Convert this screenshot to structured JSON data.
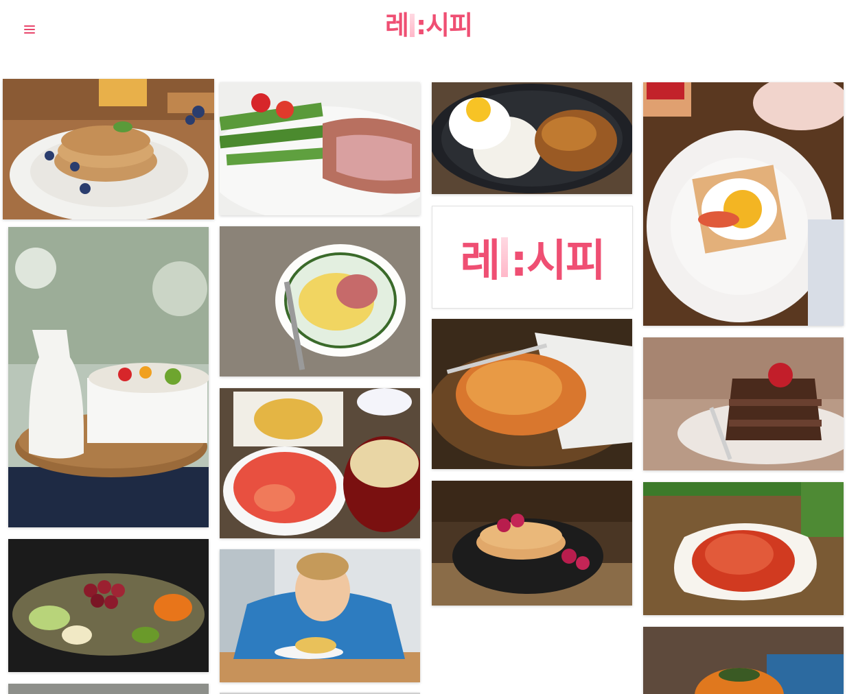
{
  "header": {
    "logo_left": "레",
    "logo_right": ":시피",
    "menu_icon": "hamburger-menu-icon"
  },
  "promo_card": {
    "logo_left": "레",
    "logo_right": ":시피"
  },
  "feed": {
    "items": [
      {
        "subject": "pancake-stack-blueberries"
      },
      {
        "subject": "steak-asparagus-tomato"
      },
      {
        "subject": "fried-egg-rice-kimchi-stirfry"
      },
      {
        "subject": "egg-toast-floral-plate"
      },
      {
        "subject": "milk-bottle-fruit-granola"
      },
      {
        "subject": "carbonara-spaghetti"
      },
      {
        "subject": "korean-pancake-basket"
      },
      {
        "subject": "chocolate-cake-strawberry"
      },
      {
        "subject": "japanese-set-meal-shrimp"
      },
      {
        "subject": "raspberry-crepes-syrup"
      },
      {
        "subject": "kimchi-dish"
      },
      {
        "subject": "fruit-carving-platter"
      },
      {
        "subject": "boy-eating-spaghetti"
      },
      {
        "subject": "persimmons"
      },
      {
        "subject": "partial-bottom-item"
      },
      {
        "subject": "partial-bottom-item-2"
      }
    ]
  }
}
